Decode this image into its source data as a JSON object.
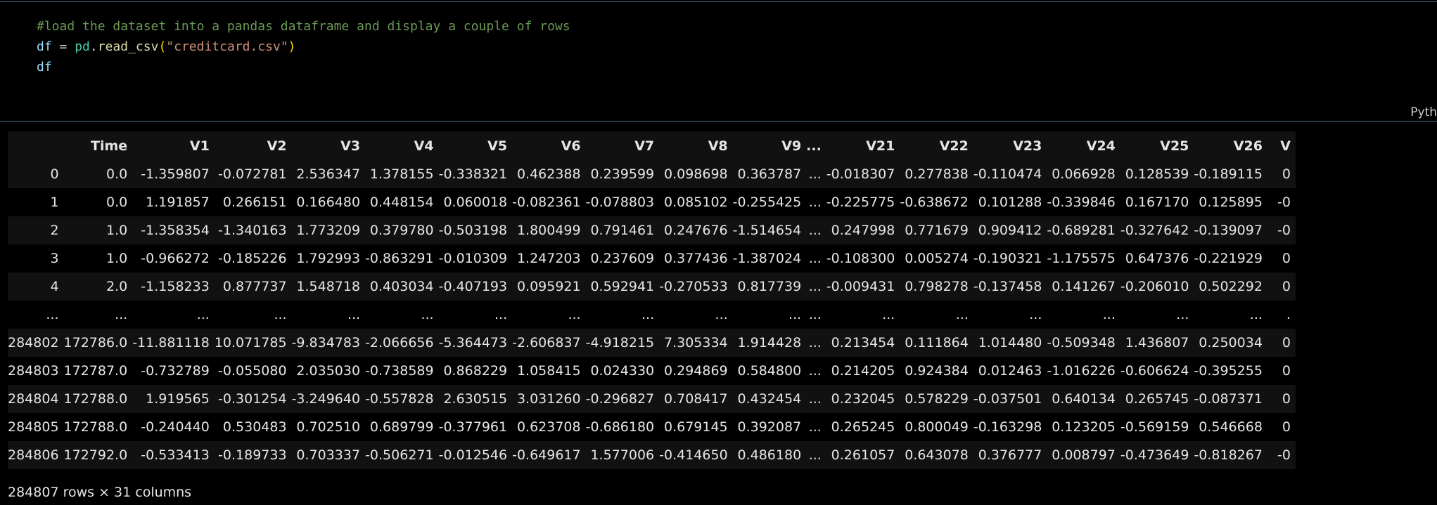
{
  "code_cell": {
    "lines": [
      [
        {
          "cls": "tok-comment",
          "text": "#load the dataset into a pandas dataframe and display a couple of rows"
        }
      ],
      [
        {
          "cls": "tok-var",
          "text": "df"
        },
        {
          "cls": "tok-op",
          "text": " = "
        },
        {
          "cls": "tok-mod",
          "text": "pd"
        },
        {
          "cls": "tok-op",
          "text": "."
        },
        {
          "cls": "tok-fn",
          "text": "read_csv"
        },
        {
          "cls": "tok-paren",
          "text": "("
        },
        {
          "cls": "tok-str",
          "text": "\"creditcard.csv\""
        },
        {
          "cls": "tok-paren",
          "text": ")"
        }
      ],
      [
        {
          "cls": "tok-var",
          "text": "df"
        }
      ]
    ],
    "language_label": "Pyth"
  },
  "dataframe": {
    "columns": [
      "",
      "Time",
      "V1",
      "V2",
      "V3",
      "V4",
      "V5",
      "V6",
      "V7",
      "V8",
      "V9",
      "...",
      "V21",
      "V22",
      "V23",
      "V24",
      "V25",
      "V26",
      "V"
    ],
    "rows": [
      [
        "0",
        "0.0",
        "-1.359807",
        "-0.072781",
        "2.536347",
        "1.378155",
        "-0.338321",
        "0.462388",
        "0.239599",
        "0.098698",
        "0.363787",
        "...",
        "-0.018307",
        "0.277838",
        "-0.110474",
        "0.066928",
        "0.128539",
        "-0.189115",
        "0"
      ],
      [
        "1",
        "0.0",
        "1.191857",
        "0.266151",
        "0.166480",
        "0.448154",
        "0.060018",
        "-0.082361",
        "-0.078803",
        "0.085102",
        "-0.255425",
        "...",
        "-0.225775",
        "-0.638672",
        "0.101288",
        "-0.339846",
        "0.167170",
        "0.125895",
        "-0"
      ],
      [
        "2",
        "1.0",
        "-1.358354",
        "-1.340163",
        "1.773209",
        "0.379780",
        "-0.503198",
        "1.800499",
        "0.791461",
        "0.247676",
        "-1.514654",
        "...",
        "0.247998",
        "0.771679",
        "0.909412",
        "-0.689281",
        "-0.327642",
        "-0.139097",
        "-0"
      ],
      [
        "3",
        "1.0",
        "-0.966272",
        "-0.185226",
        "1.792993",
        "-0.863291",
        "-0.010309",
        "1.247203",
        "0.237609",
        "0.377436",
        "-1.387024",
        "...",
        "-0.108300",
        "0.005274",
        "-0.190321",
        "-1.175575",
        "0.647376",
        "-0.221929",
        "0"
      ],
      [
        "4",
        "2.0",
        "-1.158233",
        "0.877737",
        "1.548718",
        "0.403034",
        "-0.407193",
        "0.095921",
        "0.592941",
        "-0.270533",
        "0.817739",
        "...",
        "-0.009431",
        "0.798278",
        "-0.137458",
        "0.141267",
        "-0.206010",
        "0.502292",
        "0"
      ],
      [
        "...",
        "...",
        "...",
        "...",
        "...",
        "...",
        "...",
        "...",
        "...",
        "...",
        "...",
        "...",
        "...",
        "...",
        "...",
        "...",
        "...",
        "...",
        "."
      ],
      [
        "284802",
        "172786.0",
        "-11.881118",
        "10.071785",
        "-9.834783",
        "-2.066656",
        "-5.364473",
        "-2.606837",
        "-4.918215",
        "7.305334",
        "1.914428",
        "...",
        "0.213454",
        "0.111864",
        "1.014480",
        "-0.509348",
        "1.436807",
        "0.250034",
        "0"
      ],
      [
        "284803",
        "172787.0",
        "-0.732789",
        "-0.055080",
        "2.035030",
        "-0.738589",
        "0.868229",
        "1.058415",
        "0.024330",
        "0.294869",
        "0.584800",
        "...",
        "0.214205",
        "0.924384",
        "0.012463",
        "-1.016226",
        "-0.606624",
        "-0.395255",
        "0"
      ],
      [
        "284804",
        "172788.0",
        "1.919565",
        "-0.301254",
        "-3.249640",
        "-0.557828",
        "2.630515",
        "3.031260",
        "-0.296827",
        "0.708417",
        "0.432454",
        "...",
        "0.232045",
        "0.578229",
        "-0.037501",
        "0.640134",
        "0.265745",
        "-0.087371",
        "0"
      ],
      [
        "284805",
        "172788.0",
        "-0.240440",
        "0.530483",
        "0.702510",
        "0.689799",
        "-0.377961",
        "0.623708",
        "-0.686180",
        "0.679145",
        "0.392087",
        "...",
        "0.265245",
        "0.800049",
        "-0.163298",
        "0.123205",
        "-0.569159",
        "0.546668",
        "0"
      ],
      [
        "284806",
        "172792.0",
        "-0.533413",
        "-0.189733",
        "0.703337",
        "-0.506271",
        "-0.012546",
        "-0.649617",
        "1.577006",
        "-0.414650",
        "0.486180",
        "...",
        "0.261057",
        "0.643078",
        "0.376777",
        "0.008797",
        "-0.473649",
        "-0.818267",
        "-0"
      ]
    ],
    "summary": "284807 rows × 31 columns"
  }
}
